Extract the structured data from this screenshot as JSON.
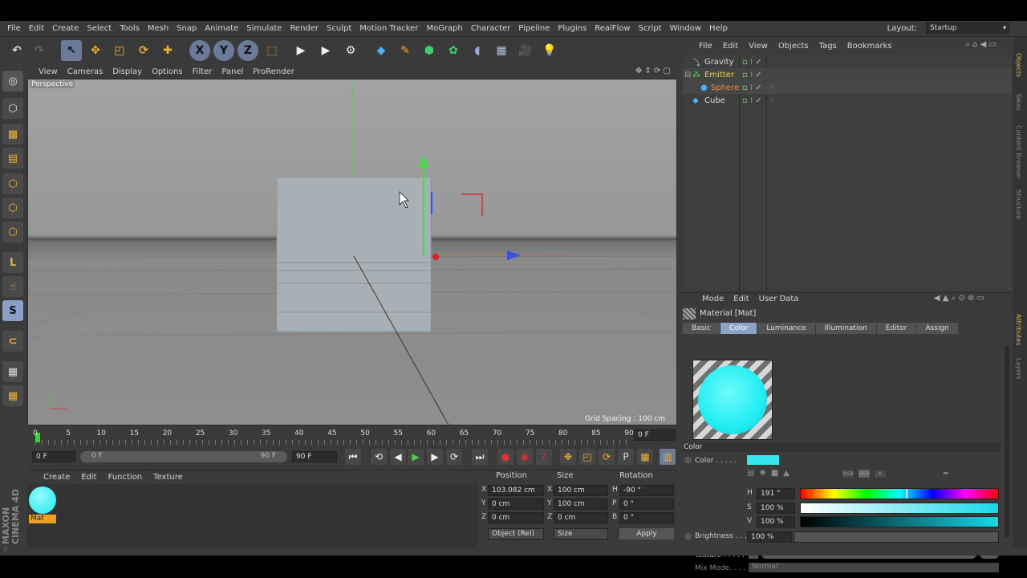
{
  "menubar": {
    "items": [
      "File",
      "Edit",
      "Create",
      "Select",
      "Tools",
      "Mesh",
      "Snap",
      "Animate",
      "Simulate",
      "Render",
      "Sculpt",
      "Motion Tracker",
      "MoGraph",
      "Character",
      "Pipeline",
      "Plugins",
      "RealFlow",
      "Script",
      "Window",
      "Help"
    ],
    "layout_label": "Layout:",
    "layout_value": "Startup"
  },
  "toolbar": {
    "axis_x": "X",
    "axis_y": "Y",
    "axis_z": "Z"
  },
  "viewport": {
    "menu": [
      "View",
      "Cameras",
      "Display",
      "Options",
      "Filter",
      "Panel",
      "ProRender"
    ],
    "label": "Perspective",
    "grid_spacing": "Grid Spacing : 100 cm"
  },
  "timeline": {
    "ticks": [
      "0",
      "5",
      "10",
      "15",
      "20",
      "25",
      "30",
      "35",
      "40",
      "45",
      "50",
      "55",
      "60",
      "65",
      "70",
      "75",
      "80",
      "85",
      "90"
    ],
    "current_frame": "0 F"
  },
  "playback": {
    "start": "0 F",
    "range_start": "0 F",
    "range_end": "90 F",
    "end": "90 F"
  },
  "materials": {
    "menu": [
      "Create",
      "Edit",
      "Function",
      "Texture"
    ],
    "items": [
      {
        "name": "Mat",
        "color": "#33f0f0"
      }
    ]
  },
  "coords": {
    "headers": [
      "Position",
      "Size",
      "Rotation"
    ],
    "rows": [
      {
        "axis": "X",
        "pos": "103.082 cm",
        "saxis": "X",
        "size": "100 cm",
        "raxis": "H",
        "rot": "-90 °"
      },
      {
        "axis": "Y",
        "pos": "0 cm",
        "saxis": "Y",
        "size": "100 cm",
        "raxis": "P",
        "rot": "0 °"
      },
      {
        "axis": "Z",
        "pos": "0 cm",
        "saxis": "Z",
        "size": "0 cm",
        "raxis": "B",
        "rot": "0 °"
      }
    ],
    "mode": "Object (Rel)",
    "size_mode": "Size",
    "apply": "Apply"
  },
  "objects": {
    "menu": [
      "File",
      "Edit",
      "View",
      "Objects",
      "Tags",
      "Bookmarks"
    ],
    "items": [
      {
        "name": "Gravity"
      },
      {
        "name": "Emitter"
      },
      {
        "name": "Sphere"
      },
      {
        "name": "Cube"
      }
    ]
  },
  "attributes": {
    "menu": [
      "Mode",
      "Edit",
      "User Data"
    ],
    "title": "Material [Mat]",
    "tabs": [
      "Basic",
      "Color",
      "Luminance",
      "Illumination",
      "Editor",
      "Assign"
    ],
    "section": "Color",
    "color_label": "Color . . . . .",
    "color_value": "#33e6f0",
    "h_label": "H",
    "h_value": "191 °",
    "s_label": "S",
    "s_value": "100 %",
    "v_label": "V",
    "v_value": "100 %",
    "brightness_label": "Brightness . . .",
    "brightness_value": "100 %",
    "texture_label": "Texture . . . . .",
    "mixmode_label": "Mix Mode. . . .",
    "mixmode_value": "Normal",
    "color_modes": [
      "RGB",
      "HSV",
      "K"
    ]
  },
  "sidebar_tabs": [
    "Objects",
    "Takes",
    "Content Browser",
    "Structure",
    "Attributes",
    "Layers"
  ],
  "brand": "MAXON CINEMA 4D"
}
